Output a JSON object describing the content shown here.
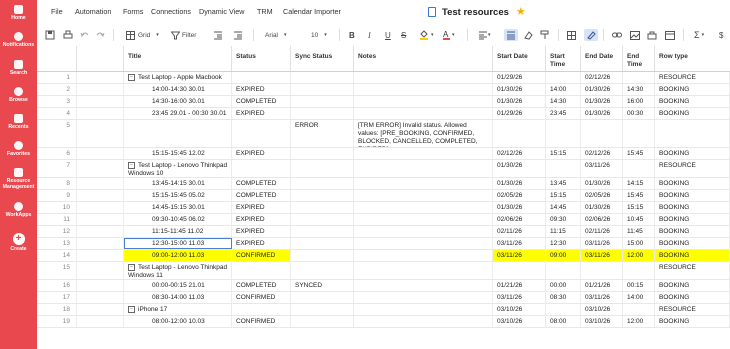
{
  "sidebar": {
    "items": [
      {
        "label": "Home",
        "icon": "home-icon"
      },
      {
        "label": "Notifications",
        "icon": "bell-icon"
      },
      {
        "label": "Search",
        "icon": "search-icon"
      },
      {
        "label": "Browse",
        "icon": "folder-icon"
      },
      {
        "label": "Recents",
        "icon": "clock-icon"
      },
      {
        "label": "Favorites",
        "icon": "star-icon"
      },
      {
        "label": "Resource Management",
        "icon": "people-icon"
      },
      {
        "label": "WorkApps",
        "icon": "workapps-icon"
      },
      {
        "label": "Create",
        "icon": "plus-icon"
      }
    ],
    "accent": "#e8484e"
  },
  "menubar": {
    "items": [
      "File",
      "Automation",
      "Forms",
      "Connections",
      "Dynamic View",
      "TRM",
      "Calendar Importer"
    ],
    "title": "Test resources"
  },
  "toolbar": {
    "view": "Grid",
    "filter": "Filter",
    "font": "Arial",
    "font_size": "10",
    "sum_symbol": "Σ",
    "currency_symbol": "$"
  },
  "grid": {
    "columns": [
      "Title",
      "Status",
      "Sync Status",
      "Notes",
      "Start Date",
      "Start Time",
      "End Date",
      "End Time",
      "Row type"
    ],
    "rows": [
      {
        "num": "1",
        "title": "Test Laptop - Apple Macbook",
        "level": 1,
        "expander": "−",
        "status": "",
        "sync": "",
        "notes": "",
        "start_date": "01/29/26",
        "start_time": "",
        "end_date": "02/12/26",
        "end_time": "",
        "row_type": "RESOURCE"
      },
      {
        "num": "2",
        "title": "14:00-14:30 30.01",
        "level": 2,
        "status": "EXPIRED",
        "sync": "",
        "notes": "",
        "start_date": "01/30/26",
        "start_time": "14:00",
        "end_date": "01/30/26",
        "end_time": "14:30",
        "row_type": "BOOKING"
      },
      {
        "num": "3",
        "title": "14:30-16:00 30.01",
        "level": 2,
        "status": "COMPLETED",
        "sync": "",
        "notes": "",
        "start_date": "01/30/26",
        "start_time": "14:30",
        "end_date": "01/30/26",
        "end_time": "16:00",
        "row_type": "BOOKING"
      },
      {
        "num": "4",
        "title": "23:45 29.01 - 00:30 30.01",
        "level": 2,
        "status": "EXPIRED",
        "sync": "",
        "notes": "",
        "start_date": "01/29/26",
        "start_time": "23:45",
        "end_date": "01/30/26",
        "end_time": "00:30",
        "row_type": "BOOKING"
      },
      {
        "num": "5",
        "title": "",
        "level": 2,
        "status": "",
        "sync": "ERROR",
        "notes": "[TRM ERROR] Invalid status. Allowed values: [PRE_BOOKING, CONFIRMED, BLOCKED, CANCELLED, COMPLETED, EXPIRED]",
        "start_date": "",
        "start_time": "",
        "end_date": "",
        "end_time": "",
        "row_type": ""
      },
      {
        "num": "6",
        "title": "15:15-15:45 12.02",
        "level": 2,
        "status": "EXPIRED",
        "sync": "",
        "notes": "",
        "start_date": "02/12/26",
        "start_time": "15:15",
        "end_date": "02/12/26",
        "end_time": "15:45",
        "row_type": "BOOKING"
      },
      {
        "num": "7",
        "title": "Test Laptop - Lenovo Thinkpad Windows 10",
        "level": 1,
        "expander": "−",
        "status": "",
        "sync": "",
        "notes": "",
        "start_date": "01/30/26",
        "start_time": "",
        "end_date": "03/11/26",
        "end_time": "",
        "row_type": "RESOURCE"
      },
      {
        "num": "8",
        "title": "13:45-14:15 30.01",
        "level": 2,
        "status": "COMPLETED",
        "sync": "",
        "notes": "",
        "start_date": "01/30/26",
        "start_time": "13:45",
        "end_date": "01/30/26",
        "end_time": "14:15",
        "row_type": "BOOKING"
      },
      {
        "num": "9",
        "title": "15:15-15:45 05.02",
        "level": 2,
        "status": "COMPLETED",
        "sync": "",
        "notes": "",
        "start_date": "02/05/26",
        "start_time": "15:15",
        "end_date": "02/05/26",
        "end_time": "15:45",
        "row_type": "BOOKING"
      },
      {
        "num": "10",
        "title": "14:45-15:15 30.01",
        "level": 2,
        "status": "EXPIRED",
        "sync": "",
        "notes": "",
        "start_date": "01/30/26",
        "start_time": "14:45",
        "end_date": "01/30/26",
        "end_time": "15:15",
        "row_type": "BOOKING"
      },
      {
        "num": "11",
        "title": "09:30-10:45 06.02",
        "level": 2,
        "status": "EXPIRED",
        "sync": "",
        "notes": "",
        "start_date": "02/06/26",
        "start_time": "09:30",
        "end_date": "02/06/26",
        "end_time": "10:45",
        "row_type": "BOOKING"
      },
      {
        "num": "12",
        "title": "11:15-11:45 11.02",
        "level": 2,
        "status": "EXPIRED",
        "sync": "",
        "notes": "",
        "start_date": "02/11/26",
        "start_time": "11:15",
        "end_date": "02/11/26",
        "end_time": "11:45",
        "row_type": "BOOKING"
      },
      {
        "num": "13",
        "title": "12:30-15:00 11.03",
        "level": 2,
        "status": "EXPIRED",
        "sync": "",
        "notes": "",
        "start_date": "03/11/26",
        "start_time": "12:30",
        "end_date": "03/11/26",
        "end_time": "15:00",
        "row_type": "BOOKING",
        "selected": true
      },
      {
        "num": "14",
        "title": "09:00-12:00 11.03",
        "level": 2,
        "status": "CONFIRMED",
        "sync": "",
        "notes": "",
        "start_date": "03/11/26",
        "start_time": "09:00",
        "end_date": "03/11/26",
        "end_time": "12:00",
        "row_type": "BOOKING",
        "highlight": true
      },
      {
        "num": "15",
        "title": "Test Laptop - Lenovo Thinkpad Windows 11",
        "level": 1,
        "expander": "−",
        "status": "",
        "sync": "",
        "notes": "",
        "start_date": "",
        "start_time": "",
        "end_date": "",
        "end_time": "",
        "row_type": "RESOURCE"
      },
      {
        "num": "16",
        "title": "00:00-00:15 21.01",
        "level": 2,
        "status": "COMPLETED",
        "sync": "SYNCED",
        "notes": "",
        "start_date": "01/21/26",
        "start_time": "00:00",
        "end_date": "01/21/26",
        "end_time": "00:15",
        "row_type": "BOOKING"
      },
      {
        "num": "17",
        "title": "08:30-14:00 11.03",
        "level": 2,
        "status": "CONFIRMED",
        "sync": "",
        "notes": "",
        "start_date": "03/11/26",
        "start_time": "08:30",
        "end_date": "03/11/26",
        "end_time": "14:00",
        "row_type": "BOOKING"
      },
      {
        "num": "18",
        "title": "iPhone 17",
        "level": 1,
        "expander": "−",
        "status": "",
        "sync": "",
        "notes": "",
        "start_date": "03/10/26",
        "start_time": "",
        "end_date": "03/10/26",
        "end_time": "",
        "row_type": "RESOURCE"
      },
      {
        "num": "19",
        "title": "08:00-12:00 10.03",
        "level": 2,
        "status": "CONFIRMED",
        "sync": "",
        "notes": "",
        "start_date": "03/10/26",
        "start_time": "08:00",
        "end_date": "03/10/26",
        "end_time": "12:00",
        "row_type": "BOOKING"
      }
    ],
    "highlight_color": "#ffff00"
  }
}
